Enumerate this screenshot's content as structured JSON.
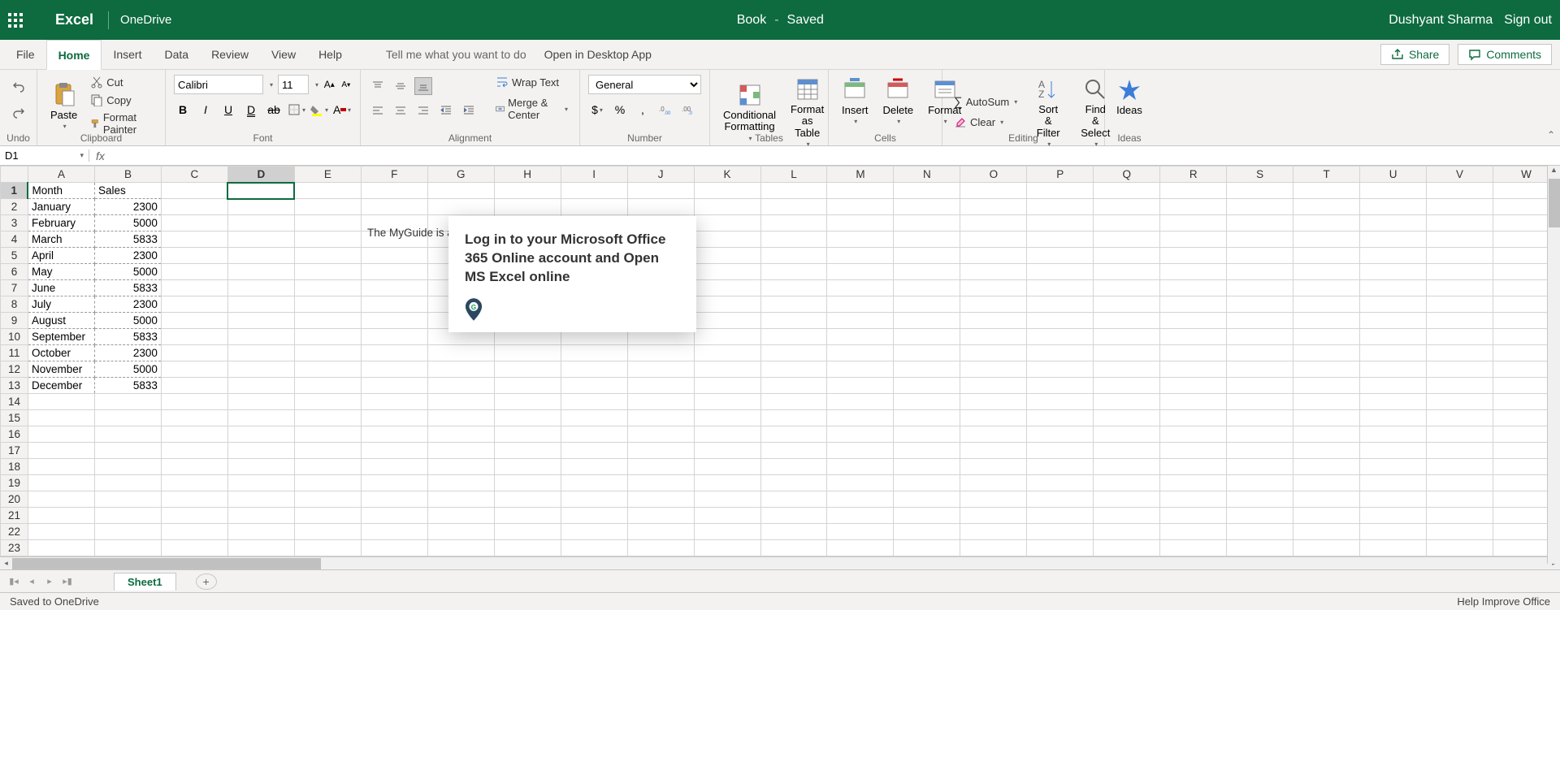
{
  "title_bar": {
    "app_name": "Excel",
    "location": "OneDrive",
    "doc_name": "Book",
    "save_state": "Saved",
    "user_name": "Dushyant Sharma",
    "sign_out": "Sign out"
  },
  "menu": {
    "tabs": [
      "File",
      "Home",
      "Insert",
      "Data",
      "Review",
      "View",
      "Help"
    ],
    "active_tab": "Home",
    "tell_me": "Tell me what you want to do",
    "desktop_app": "Open in Desktop App",
    "share": "Share",
    "comments": "Comments"
  },
  "ribbon": {
    "undo_redo": {
      "group": "Undo",
      "undo": "",
      "redo": ""
    },
    "clipboard": {
      "group": "Clipboard",
      "paste": "Paste",
      "cut": "Cut",
      "copy": "Copy",
      "format_painter": "Format Painter"
    },
    "font": {
      "group": "Font",
      "name": "Calibri",
      "size": "11"
    },
    "alignment": {
      "group": "Alignment",
      "wrap": "Wrap Text",
      "merge": "Merge & Center"
    },
    "number": {
      "group": "Number",
      "format": "General"
    },
    "tables": {
      "group": "Tables",
      "cond_fmt": "Conditional Formatting",
      "as_table": "Format as Table"
    },
    "cells": {
      "group": "Cells",
      "insert": "Insert",
      "delete": "Delete",
      "format": "Format"
    },
    "editing": {
      "group": "Editing",
      "autosum": "AutoSum",
      "clear": "Clear",
      "sort": "Sort & Filter",
      "find": "Find & Select"
    },
    "ideas": {
      "group": "Ideas",
      "ideas": "Ideas"
    }
  },
  "name_box": "D1",
  "formula": "",
  "columns": [
    "A",
    "B",
    "C",
    "D",
    "E",
    "F",
    "G",
    "H",
    "I",
    "J",
    "K",
    "L",
    "M",
    "N",
    "O",
    "P",
    "Q",
    "R",
    "S",
    "T",
    "U",
    "V",
    "W"
  ],
  "selected_cell": {
    "col": "D",
    "row": 1
  },
  "rows": 23,
  "data": {
    "headers": [
      "Month",
      "Sales"
    ],
    "records": [
      {
        "m": "January",
        "s": 2300
      },
      {
        "m": "February",
        "s": 5000
      },
      {
        "m": "March",
        "s": 5833
      },
      {
        "m": "April",
        "s": 2300
      },
      {
        "m": "May",
        "s": 5000
      },
      {
        "m": "June",
        "s": 5833
      },
      {
        "m": "July",
        "s": 2300
      },
      {
        "m": "August",
        "s": 5000
      },
      {
        "m": "September",
        "s": 5833
      },
      {
        "m": "October",
        "s": 2300
      },
      {
        "m": "November",
        "s": 5000
      },
      {
        "m": "December",
        "s": 5833
      }
    ]
  },
  "behind_text": "The MyGuide is a",
  "popup": {
    "message": "Log in to your Microsoft Office 365 Online account and Open MS Excel online"
  },
  "sheet_bar": {
    "sheet": "Sheet1"
  },
  "status_bar": {
    "left": "Saved to OneDrive",
    "right": "Help Improve Office"
  }
}
